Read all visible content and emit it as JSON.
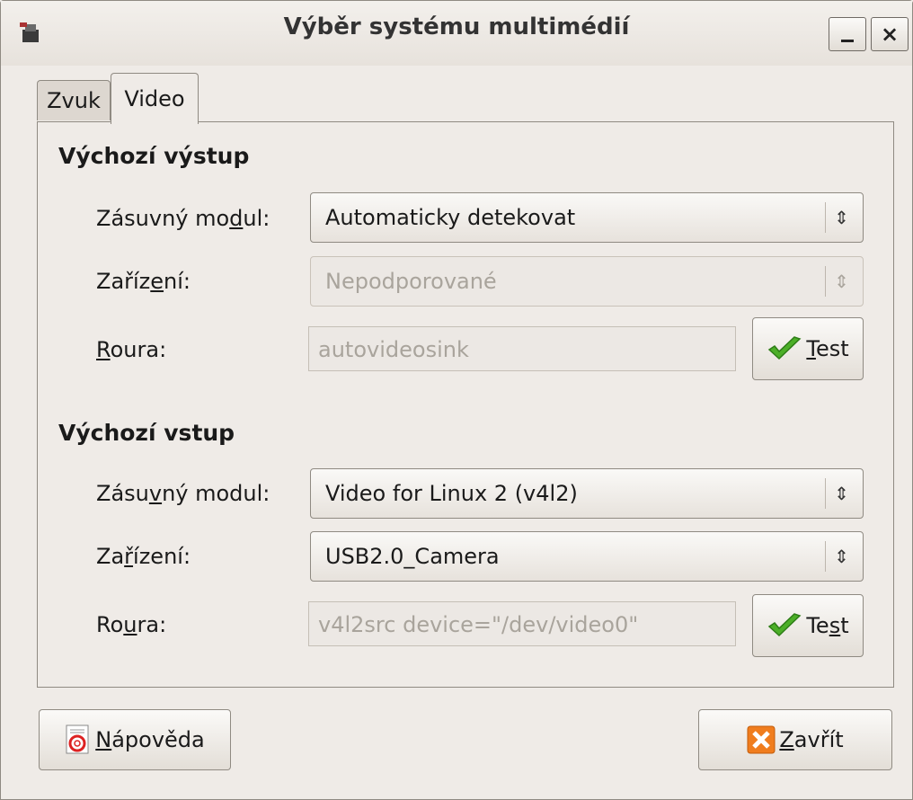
{
  "window": {
    "title": "Výběr systému multimédií",
    "controls": {
      "minimize": "_",
      "close": "×"
    }
  },
  "tabs": [
    {
      "label": "Zvuk",
      "active": false
    },
    {
      "label": "Video",
      "active": true
    }
  ],
  "output": {
    "heading": "Výchozí výstup",
    "plugin": {
      "label_pre": "Zásuvný mo",
      "label_mn": "d",
      "label_post": "ul:",
      "value": "Automaticky detekovat"
    },
    "device": {
      "label_pre": "Zaříz",
      "label_mn": "e",
      "label_post": "ní:",
      "value": "Nepodporované",
      "disabled": true
    },
    "pipeline": {
      "label_pre": "",
      "label_mn": "R",
      "label_post": "oura:",
      "value": "autovideosink",
      "disabled": true
    },
    "test": {
      "pre": "",
      "mn": "T",
      "post": "est"
    }
  },
  "input": {
    "heading": "Výchozí vstup",
    "plugin": {
      "label_pre": "Zásu",
      "label_mn": "v",
      "label_post": "ný modul:",
      "value": "Video for Linux 2 (v4l2)"
    },
    "device": {
      "label_pre": "Za",
      "label_mn": "ř",
      "label_post": "ízení:",
      "value": "USB2.0_Camera"
    },
    "pipeline": {
      "label_pre": "Ro",
      "label_mn": "u",
      "label_post": "ra:",
      "value": "v4l2src device=\"/dev/video0\"",
      "disabled": true
    },
    "test": {
      "pre": "Te",
      "mn": "s",
      "post": "t"
    }
  },
  "buttons": {
    "help": {
      "pre": "",
      "mn": "N",
      "post": "ápověda"
    },
    "close": {
      "pre": "",
      "mn": "Z",
      "post": "avřít"
    }
  },
  "colors": {
    "check_green": "#4caf28",
    "close_orange": "#f07d1e",
    "disabled_text": "#a9a49c"
  },
  "icons": {
    "combo_arrows": "⇕",
    "window_icon": "app-icon",
    "help_icon": "lifebuoy-icon",
    "close_icon": "close-x-icon",
    "test_icon": "checkmark-icon"
  }
}
